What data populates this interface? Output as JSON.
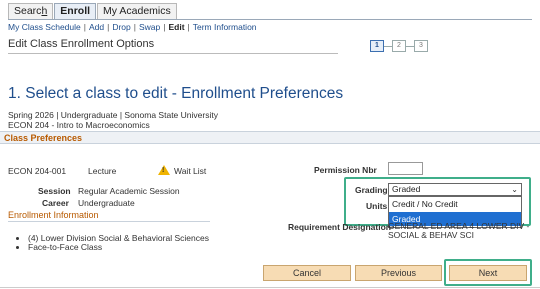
{
  "tabs": [
    {
      "label_pre": "Searc",
      "label_u": "h",
      "label_post": ""
    },
    {
      "label": "Enroll"
    },
    {
      "label": "My Academics"
    }
  ],
  "subnav": {
    "items": [
      "My Class Schedule",
      "Add",
      "Drop",
      "Swap",
      "Edit",
      "Term Information"
    ],
    "separator": "|"
  },
  "page": {
    "header_title": "Edit Class Enrollment Options",
    "steps": [
      "1",
      "2",
      "3"
    ],
    "section_title": "1.  Select a class to edit - Enrollment Preferences",
    "term_line": "Spring 2026 | Undergraduate | Sonoma State University",
    "course_line": "ECON  204 - Intro to Macroeconomics"
  },
  "class_preferences": {
    "title": "Class Preferences",
    "class_nbr": "ECON  204-001",
    "component": "Lecture",
    "status": "Wait List",
    "session_label": "Session",
    "session_value": "Regular Academic Session",
    "career_label": "Career",
    "career_value": "Undergraduate",
    "permission_label": "Permission Nbr",
    "permission_value": "",
    "grading_label": "Grading",
    "grading_selected": "Graded",
    "grading_options": [
      "Credit / No Credit",
      "Graded"
    ],
    "units_label": "Units",
    "requirement_label": "Requirement Designation",
    "requirement_value_1": "GENERAL ED AREA 4 LOWER DIV -",
    "requirement_value_2": "SOCIAL & BEHAV SCI"
  },
  "enrollment_info": {
    "title": "Enrollment Information",
    "bullets": [
      "(4) Lower Division Social & Behavioral Sciences",
      "Face-to-Face Class"
    ]
  },
  "buttons": {
    "cancel": "Cancel",
    "previous": "Previous",
    "next": "Next"
  },
  "colors": {
    "accent_blue": "#1f4e8c",
    "highlight_green": "#3fae8a",
    "section_orange": "#b85a00",
    "button_bg": "#f7dcb4",
    "selected_option": "#1f6fd1"
  }
}
